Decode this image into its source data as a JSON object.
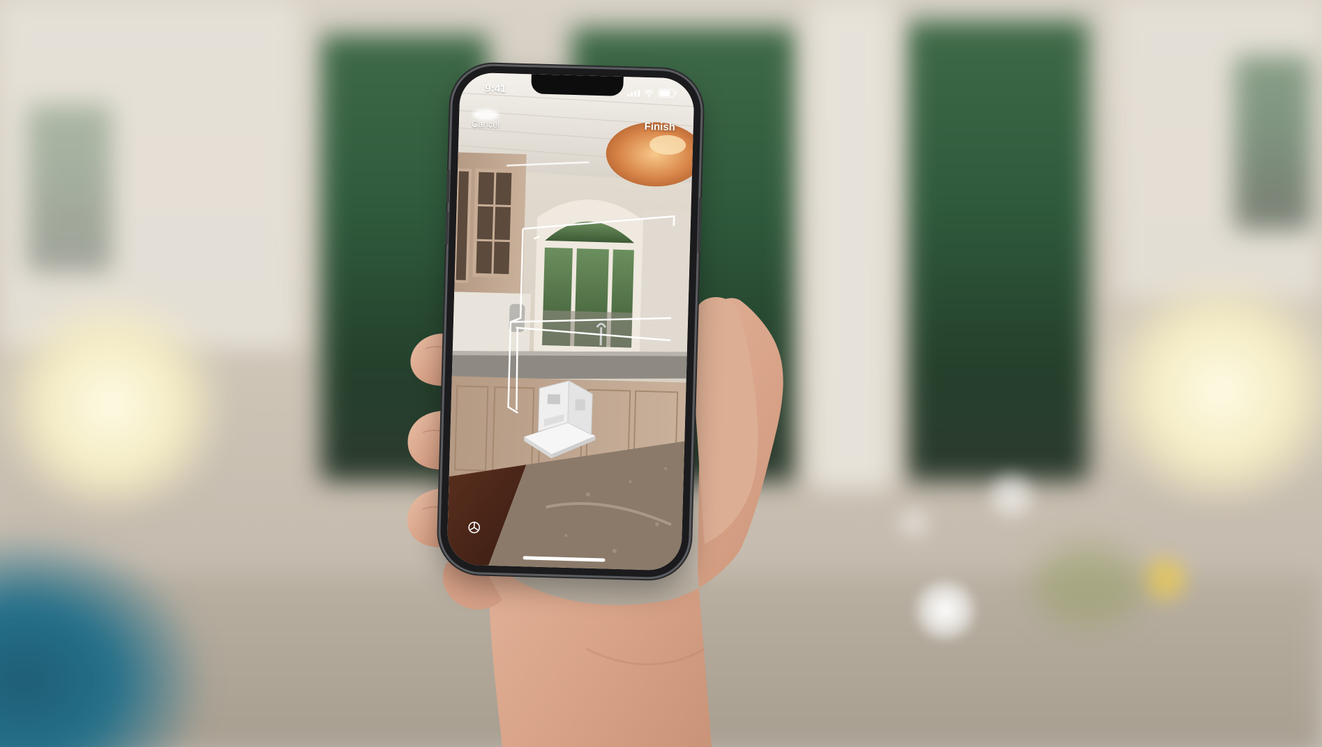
{
  "status_bar": {
    "time": "9:41"
  },
  "controls": {
    "cancel_label": "Cancel",
    "finish_label": "Finish"
  },
  "icons": {
    "signal": "cellular-signal-icon",
    "wifi": "wifi-icon",
    "battery": "battery-icon",
    "bottom_left": "viewfinder-icon"
  },
  "colors": {
    "scan_outline": "#ffffff",
    "text": "#ffffff"
  }
}
